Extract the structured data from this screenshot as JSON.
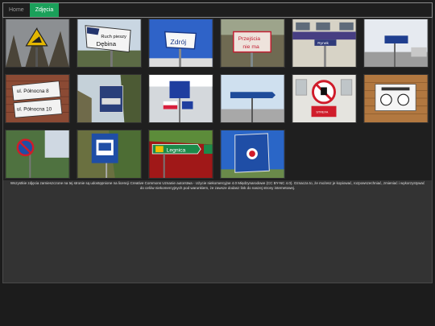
{
  "nav": {
    "items": [
      {
        "label": "Home",
        "active": false
      },
      {
        "label": "Zdjęcia",
        "active": true
      }
    ]
  },
  "photos": [
    {
      "sign": "Warning sign",
      "text": ""
    },
    {
      "sign": "Direction sign",
      "text": "Ruch pieszy Dębina"
    },
    {
      "sign": "Direction sign",
      "text": "Zdrój"
    },
    {
      "sign": "Information sign",
      "text": "Przejścia nie ma"
    },
    {
      "sign": "Information sign",
      "text": "Rynek"
    },
    {
      "sign": "Direction sign",
      "text": ""
    },
    {
      "sign": "Street name sign",
      "text": "ul. Północna 8 ul. Północna 10"
    },
    {
      "sign": "Street sign",
      "text": ""
    },
    {
      "sign": "Information sign",
      "text": ""
    },
    {
      "sign": "Direction sign",
      "text": ""
    },
    {
      "sign": "Prohibition sign",
      "text": "Strefa nieupoważnionym wstęp zabroniony"
    },
    {
      "sign": "Prohibition sign",
      "text": "Tu wolno palić"
    },
    {
      "sign": "No parking sign",
      "text": ""
    },
    {
      "sign": "Bus stop sign",
      "text": ""
    },
    {
      "sign": "Direction sign",
      "text": "Legnica"
    },
    {
      "sign": "Border sign",
      "text": ""
    }
  ],
  "footer": {
    "text": "Wszystkie zdjęcia zamieszczone na tej stronie są udostępnione na licencji Creative Commons Uznanie autorstwa - Użycie niekomercyjne 4.0 Międzynarodowe (CC BY-NC 4.0). Oznacza to, że możesz je kopiować, rozpowszechniać, zmieniać i wykorzystywać do celów niekomercyjnych pod warunkiem, że zawsze dodasz link do naszej strony internetowej."
  },
  "colors": {
    "accent": "#1aa05a",
    "background": "#1c1c1c",
    "footer": "#333333"
  }
}
